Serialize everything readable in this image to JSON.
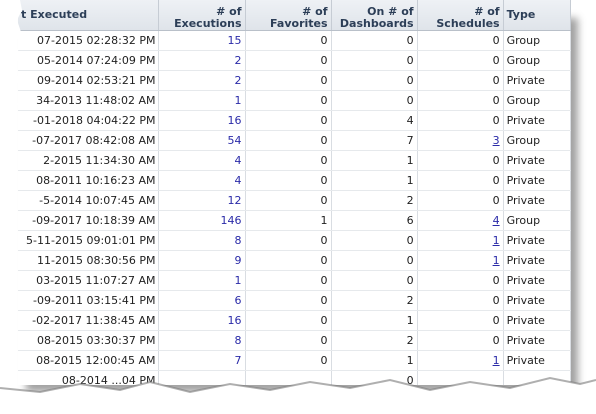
{
  "headers": {
    "last_executed": "t Executed",
    "executions": [
      "# of",
      "Executions"
    ],
    "favorites": [
      "# of",
      "Favorites"
    ],
    "dashboards": [
      "On # of",
      "Dashboards"
    ],
    "schedules": [
      "# of",
      "Schedules"
    ],
    "type": "Type"
  },
  "rows": [
    {
      "date": "07-2015 02:28:32 PM",
      "executions": "15",
      "favorites": "0",
      "dashboards": "0",
      "schedules": "0",
      "schedules_link": false,
      "type": "Group"
    },
    {
      "date": "05-2014 07:24:09 PM",
      "executions": "2",
      "favorites": "0",
      "dashboards": "0",
      "schedules": "0",
      "schedules_link": false,
      "type": "Group"
    },
    {
      "date": "09-2014 02:53:21 PM",
      "executions": "2",
      "favorites": "0",
      "dashboards": "0",
      "schedules": "0",
      "schedules_link": false,
      "type": "Private"
    },
    {
      "date": "34-2013 11:48:02 AM",
      "executions": "1",
      "favorites": "0",
      "dashboards": "0",
      "schedules": "0",
      "schedules_link": false,
      "type": "Group"
    },
    {
      "date": "-01-2018 04:04:22 PM",
      "executions": "16",
      "favorites": "0",
      "dashboards": "4",
      "schedules": "0",
      "schedules_link": false,
      "type": "Private"
    },
    {
      "date": "-07-2017 08:42:08 AM",
      "executions": "54",
      "favorites": "0",
      "dashboards": "7",
      "schedules": "3",
      "schedules_link": true,
      "type": "Group"
    },
    {
      "date": "2-2015 11:34:30 AM",
      "executions": "4",
      "favorites": "0",
      "dashboards": "1",
      "schedules": "0",
      "schedules_link": false,
      "type": "Private"
    },
    {
      "date": "08-2011 10:16:23 AM",
      "executions": "4",
      "favorites": "0",
      "dashboards": "1",
      "schedules": "0",
      "schedules_link": false,
      "type": "Private"
    },
    {
      "date": "-5-2014 10:07:45 AM",
      "executions": "12",
      "favorites": "0",
      "dashboards": "2",
      "schedules": "0",
      "schedules_link": false,
      "type": "Private"
    },
    {
      "date": "-09-2017 10:18:39 AM",
      "executions": "146",
      "favorites": "1",
      "dashboards": "6",
      "schedules": "4",
      "schedules_link": true,
      "type": "Group"
    },
    {
      "date": "5-11-2015 09:01:01 PM",
      "executions": "8",
      "favorites": "0",
      "dashboards": "0",
      "schedules": "1",
      "schedules_link": true,
      "type": "Private"
    },
    {
      "date": "11-2015 08:30:56 PM",
      "executions": "9",
      "favorites": "0",
      "dashboards": "0",
      "schedules": "1",
      "schedules_link": true,
      "type": "Private"
    },
    {
      "date": "03-2015 11:07:27 AM",
      "executions": "1",
      "favorites": "0",
      "dashboards": "0",
      "schedules": "0",
      "schedules_link": false,
      "type": "Private"
    },
    {
      "date": "-09-2011 03:15:41 PM",
      "executions": "6",
      "favorites": "0",
      "dashboards": "2",
      "schedules": "0",
      "schedules_link": false,
      "type": "Private"
    },
    {
      "date": "-02-2017 11:38:45 AM",
      "executions": "16",
      "favorites": "0",
      "dashboards": "1",
      "schedules": "0",
      "schedules_link": false,
      "type": "Private"
    },
    {
      "date": "08-2015 03:30:37 PM",
      "executions": "8",
      "favorites": "0",
      "dashboards": "2",
      "schedules": "0",
      "schedules_link": false,
      "type": "Private"
    },
    {
      "date": "08-2015 12:00:45 AM",
      "executions": "7",
      "favorites": "0",
      "dashboards": "1",
      "schedules": "1",
      "schedules_link": true,
      "type": "Private"
    },
    {
      "date": "08-2014 ...04 PM",
      "executions": "",
      "favorites": "",
      "dashboards": "0",
      "schedules": "",
      "schedules_link": false,
      "type": ""
    }
  ],
  "colors": {
    "link": "#2a2aa8",
    "header_text": "#2c3e57",
    "header_bg": "#e6eaef"
  }
}
